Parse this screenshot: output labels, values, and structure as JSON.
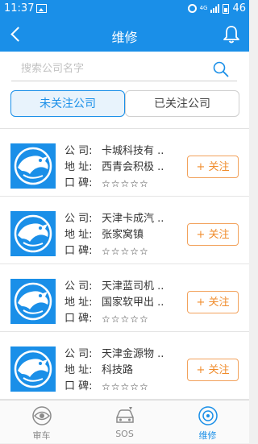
{
  "status_bar": {
    "time": "11:37",
    "network": "4G",
    "battery": "46"
  },
  "header": {
    "title": "维修"
  },
  "search": {
    "placeholder": "搜索公司名字"
  },
  "tabs": [
    {
      "label": "未关注公司",
      "active": true
    },
    {
      "label": "已关注公司",
      "active": false
    }
  ],
  "labels": {
    "company": "公  司:",
    "address": "地  址:",
    "reputation": "口  碑:"
  },
  "companies": [
    {
      "name": "卡城科技有 ..",
      "address": "西青会积极 ..",
      "rating": "☆☆☆☆☆",
      "follow": "+ 关注"
    },
    {
      "name": "天津卡成汽 ..",
      "address": "张家窝镇",
      "rating": "☆☆☆☆☆",
      "follow": "+ 关注"
    },
    {
      "name": "天津蓝司机 ..",
      "address": "国家软甲出 ..",
      "rating": "☆☆☆☆☆",
      "follow": "+ 关注"
    },
    {
      "name": "天津金源物 ..",
      "address": "科技路",
      "rating": "☆☆☆☆☆",
      "follow": "+ 关注"
    }
  ],
  "bottom_nav": [
    {
      "label": "审车",
      "icon": "eye-icon",
      "active": false
    },
    {
      "label": "SOS",
      "icon": "car-icon",
      "active": false
    },
    {
      "label": "维修",
      "icon": "target-icon",
      "active": true
    }
  ],
  "colors": {
    "primary": "#1a8fe8",
    "follow_accent": "#f08c2c",
    "star": "#9a9a9a"
  }
}
